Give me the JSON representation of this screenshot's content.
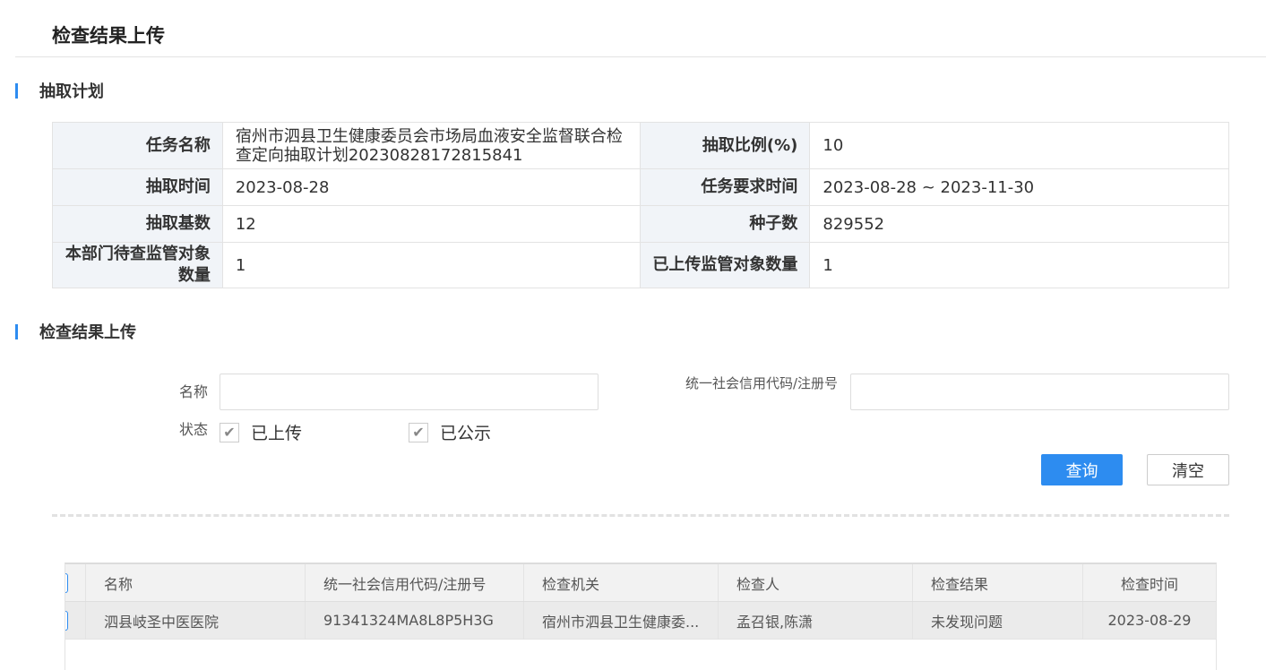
{
  "page": {
    "title": "检查结果上传"
  },
  "sections": {
    "plan": "抽取计划",
    "upload": "检查结果上传"
  },
  "plan": {
    "task_name_label": "任务名称",
    "task_name_value": "宿州市泗县卫生健康委员会市场局血液安全监督联合检查定向抽取计划20230828172815841",
    "ratio_label": "抽取比例(%)",
    "ratio_value": "10",
    "time_label": "抽取时间",
    "time_value": "2023-08-28",
    "required_time_label": "任务要求时间",
    "required_time_value": "2023-08-28 ~ 2023-11-30",
    "base_label": "抽取基数",
    "base_value": "12",
    "seed_label": "种子数",
    "seed_value": "829552",
    "pending_label": "本部门待查监管对象数量",
    "pending_value": "1",
    "uploaded_label": "已上传监管对象数量",
    "uploaded_value": "1"
  },
  "filter": {
    "name_label": "名称",
    "name_value": "",
    "code_label": "统一社会信用代码/注册号",
    "code_value": "",
    "status_label": "状态",
    "status_options": [
      {
        "label": "已上传",
        "checked": true
      },
      {
        "label": "已公示",
        "checked": true
      }
    ],
    "query_button": "查询",
    "clear_button": "清空"
  },
  "grid": {
    "columns": [
      "名称",
      "统一社会信用代码/注册号",
      "检查机关",
      "检查人",
      "检查结果",
      "检查时间"
    ],
    "rows": [
      [
        "泗县岐圣中医医院",
        "91341324MA8L8P5H3G",
        "宿州市泗县卫生健康委...",
        "孟召银,陈潇",
        "未发现问题",
        "2023-08-29"
      ]
    ]
  }
}
